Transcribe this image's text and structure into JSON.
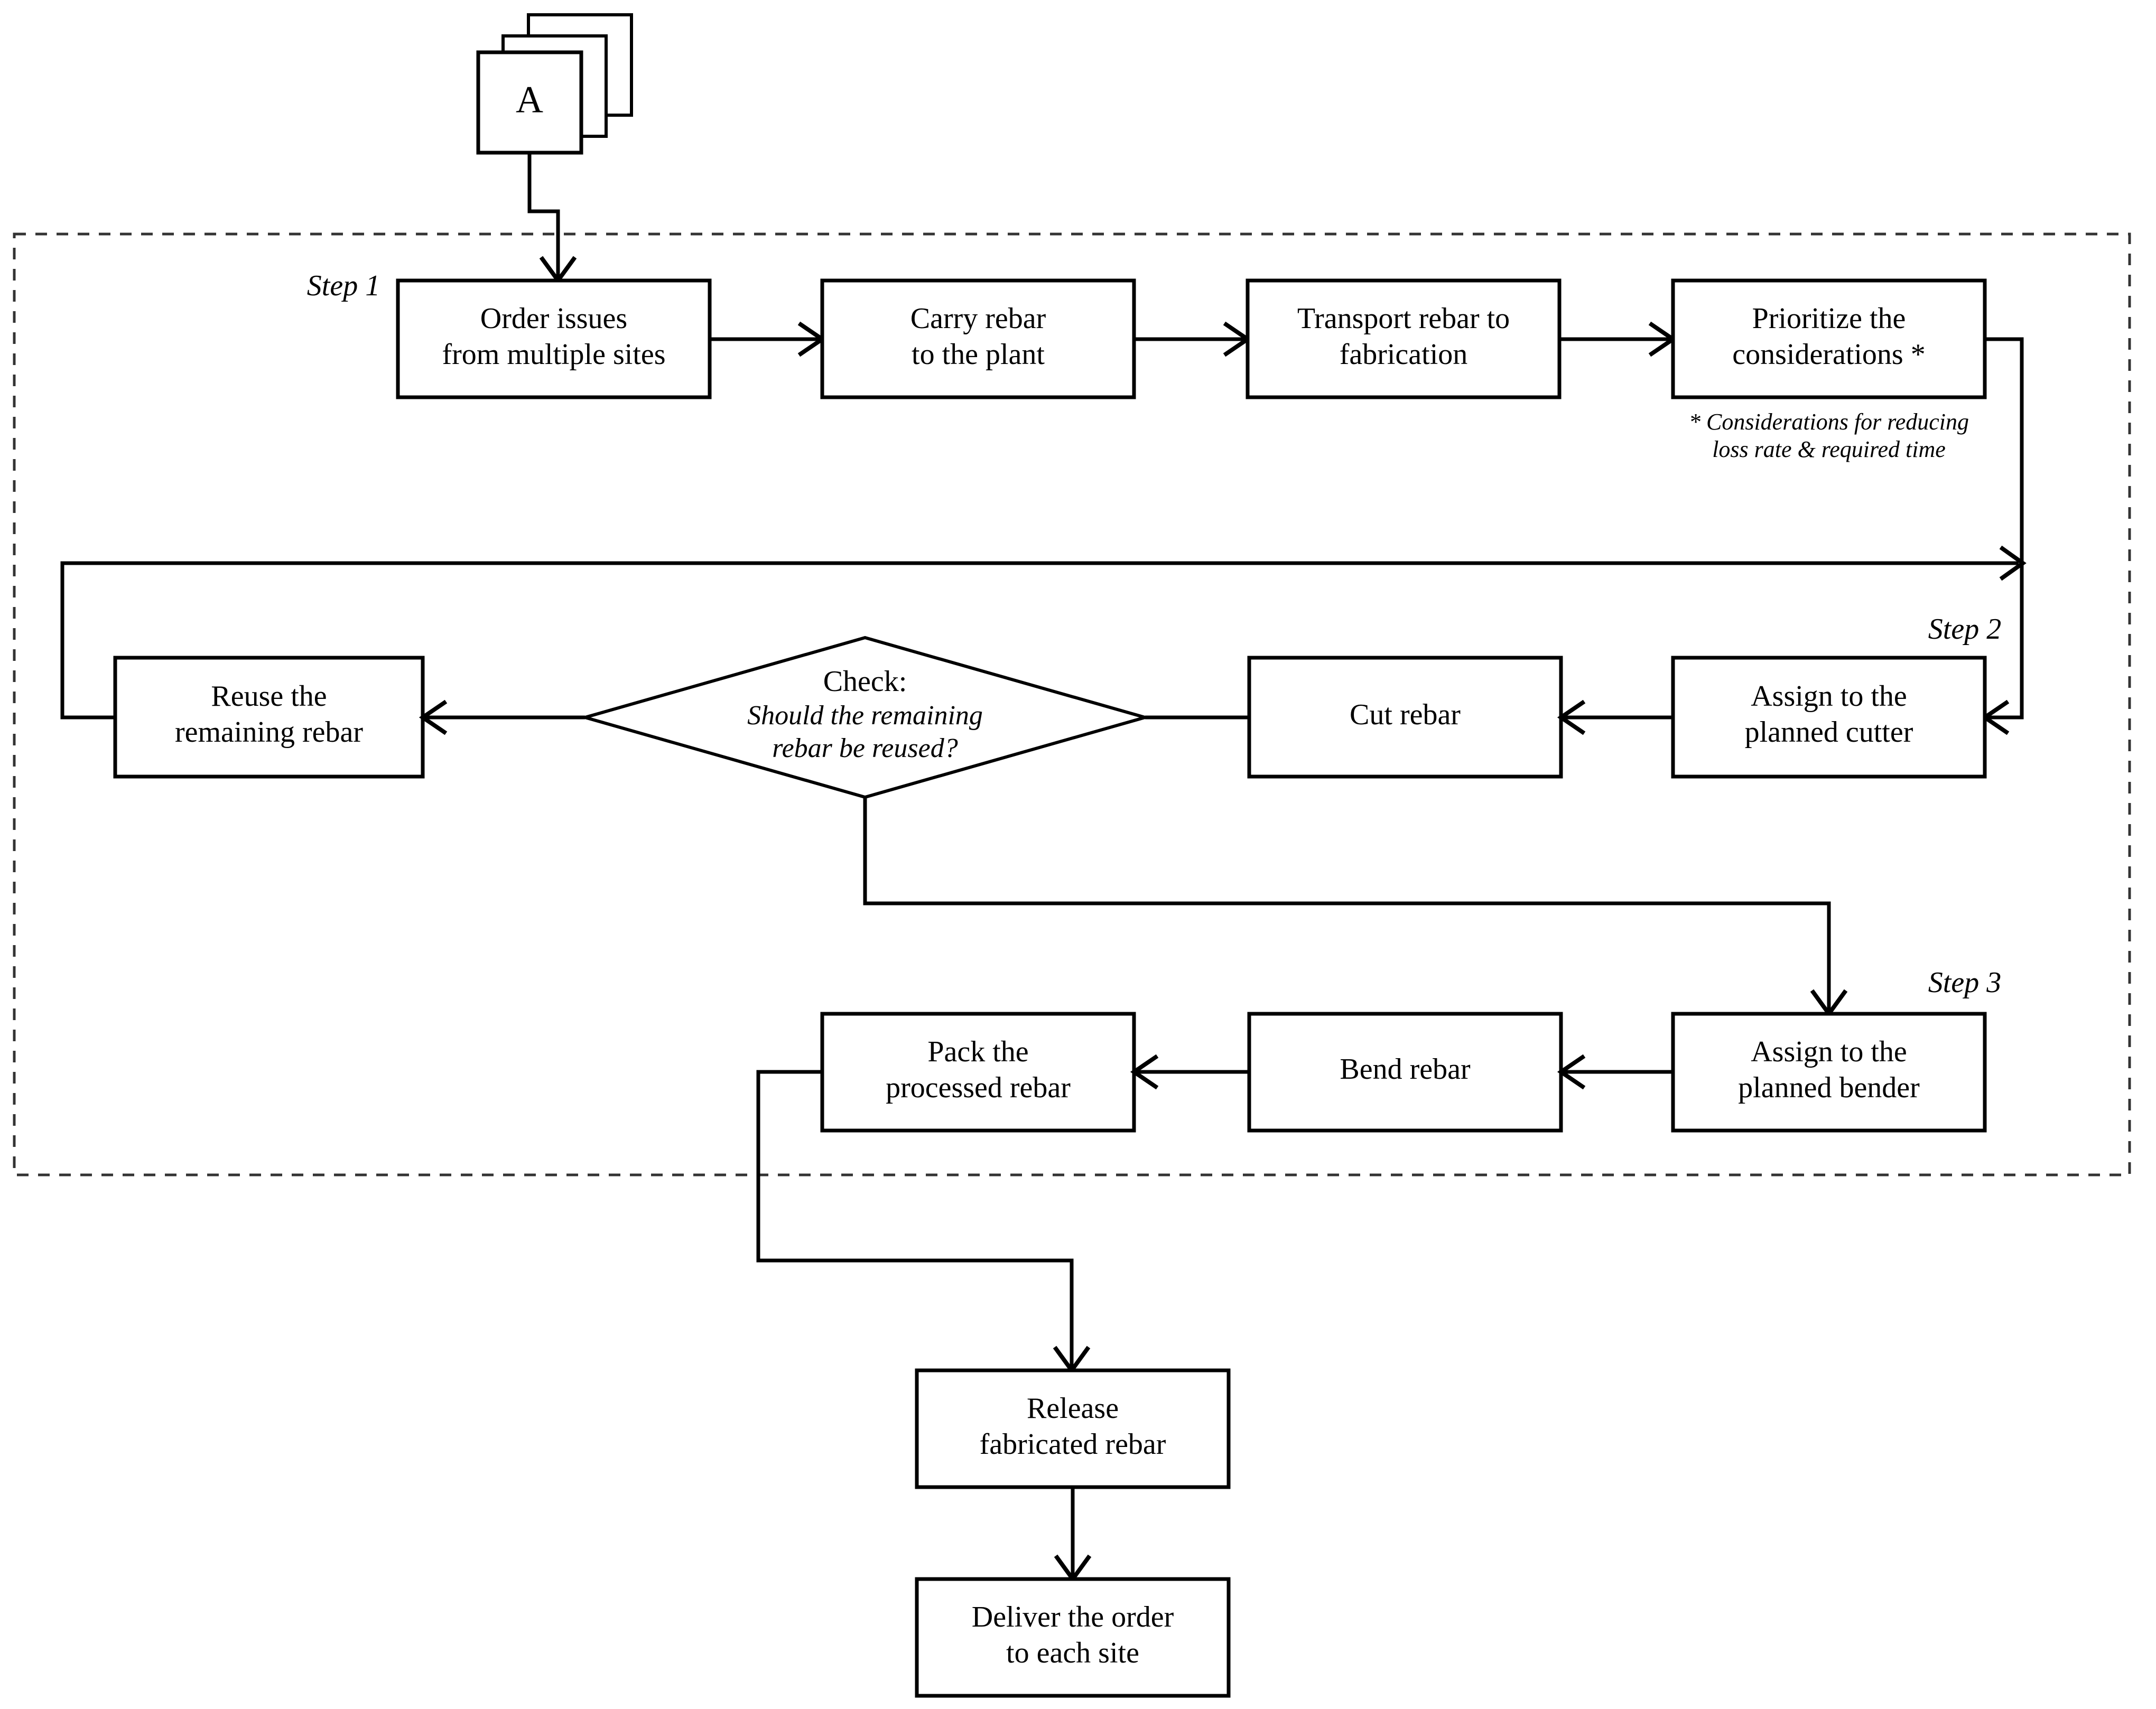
{
  "diagram": {
    "title_letter": "A",
    "group_label": "process-group",
    "step_labels": [
      {
        "id": "step1",
        "text": "Step 1"
      },
      {
        "id": "step2",
        "text": "Step 2"
      },
      {
        "id": "step3",
        "text": "Step 3"
      }
    ],
    "footnote": {
      "line1": "* Considerations for reducing",
      "line2": "loss rate & required time"
    },
    "nodes": {
      "start_card": {
        "label": "A",
        "shape": "stacked-document"
      },
      "order_issues": {
        "line1": "Order issues",
        "line2": "from multiple sites",
        "shape": "rect"
      },
      "carry_rebar": {
        "line1": "Carry rebar",
        "line2": "to the plant",
        "shape": "rect"
      },
      "transport_rebar": {
        "line1": "Transport rebar to",
        "line2": "fabrication",
        "shape": "rect"
      },
      "prioritize": {
        "line1": "Prioritize the",
        "line2": "considerations *",
        "shape": "rect"
      },
      "assign_cutter": {
        "line1": "Assign to the",
        "line2": "planned cutter",
        "shape": "rect"
      },
      "cut_rebar": {
        "line1": "Cut rebar",
        "line2": "",
        "shape": "rect"
      },
      "check_decision": {
        "line1": "Check:",
        "line2": "Should the remaining",
        "line3": "rebar be reused?",
        "shape": "diamond"
      },
      "reuse_rebar": {
        "line1": "Reuse the",
        "line2": "remaining rebar",
        "shape": "rect"
      },
      "assign_bender": {
        "line1": "Assign to the",
        "line2": "planned bender",
        "shape": "rect"
      },
      "bend_rebar": {
        "line1": "Bend rebar",
        "line2": "",
        "shape": "rect"
      },
      "pack_rebar": {
        "line1": "Pack the",
        "line2": "processed rebar",
        "shape": "rect"
      },
      "release_rebar": {
        "line1": "Release",
        "line2": "fabricated rebar",
        "shape": "rect"
      },
      "deliver_order": {
        "line1": "Deliver the order",
        "line2": "to each site",
        "shape": "rect"
      }
    },
    "colors": {
      "stroke": "#000000",
      "fill": "#ffffff",
      "group_stroke": "#333333",
      "background": "#ffffff"
    }
  }
}
